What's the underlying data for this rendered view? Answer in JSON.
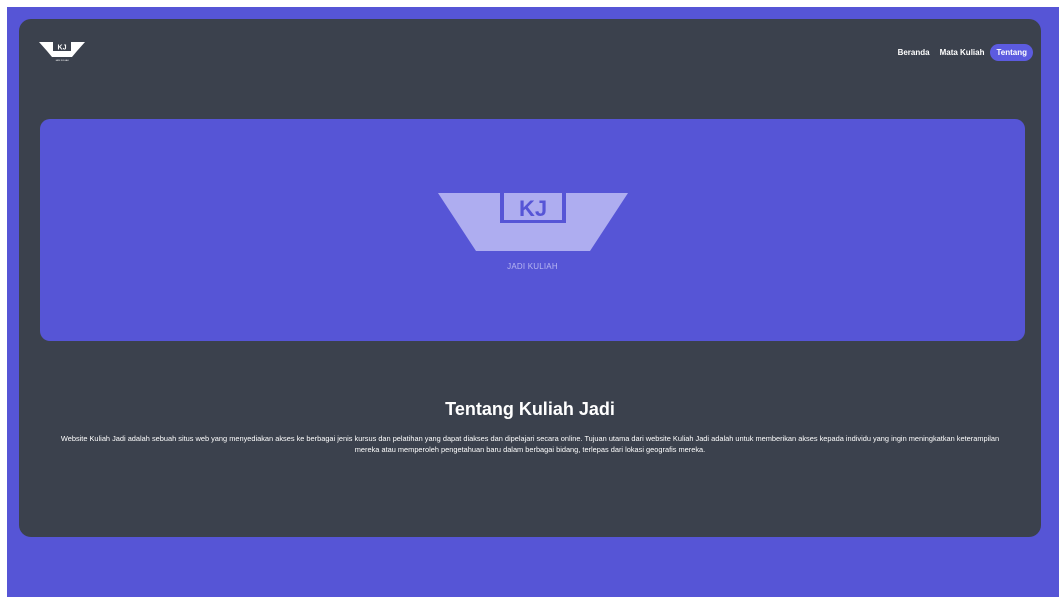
{
  "brand": {
    "logo_mark": "KJ",
    "logo_caption": "JADI KULIAH",
    "colors": {
      "accent": "#5655d6",
      "card": "#3b414d",
      "logo_fill": "#aeadf0",
      "text": "#ffffff"
    }
  },
  "nav": {
    "items": [
      {
        "label": "Beranda",
        "active": false
      },
      {
        "label": "Mata Kuliah",
        "active": false
      },
      {
        "label": "Tentang",
        "active": true
      }
    ]
  },
  "hero": {
    "logo_text": "KJ",
    "subtitle": "JADI KULIAH"
  },
  "about": {
    "title": "Tentang Kuliah Jadi",
    "description": "Website Kuliah Jadi adalah sebuah situs web yang menyediakan akses ke berbagai jenis kursus dan pelatihan yang dapat diakses dan dipelajari secara online. Tujuan utama dari website Kuliah Jadi adalah untuk memberikan akses kepada individu yang ingin meningkatkan keterampilan mereka atau memperoleh pengetahuan baru dalam berbagai bidang, terlepas dari lokasi geografis mereka."
  }
}
